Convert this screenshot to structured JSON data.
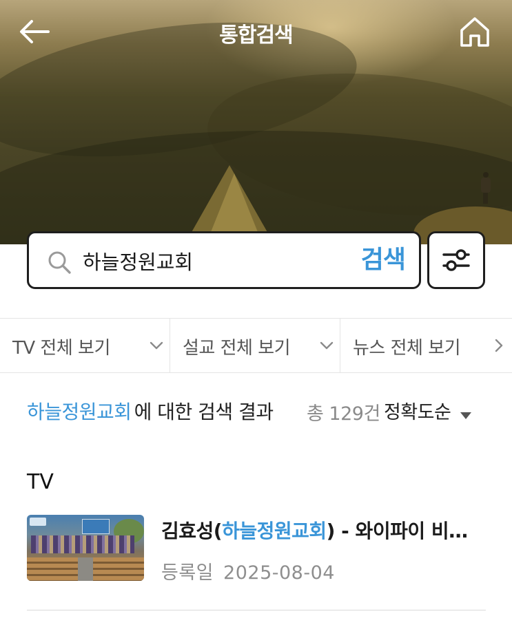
{
  "header": {
    "title": "통합검색",
    "back_icon": "back-arrow-icon",
    "home_icon": "home-icon"
  },
  "search": {
    "value": "하늘정원교회",
    "submit_label": "검색",
    "search_icon": "magnifier-icon",
    "filter_icon": "sliders-icon"
  },
  "categories": [
    {
      "label": "TV 전체 보기",
      "icon": "chevron-down-icon"
    },
    {
      "label": "설교 전체 보기",
      "icon": "chevron-down-icon"
    },
    {
      "label": "뉴스 전체 보기",
      "icon": "chevron-right-icon"
    }
  ],
  "results": {
    "keyword": "하늘정원교회",
    "suffix": "에 대한 검색 결과",
    "count": "총 129건",
    "sort": "정확도순"
  },
  "sections": [
    {
      "title": "TV",
      "items": [
        {
          "title_prefix": "김효성(",
          "title_highlight": "하늘정원교회",
          "title_suffix": ") - 와이파이 비…",
          "date_label": "등록일",
          "date": "2025-08-04"
        }
      ]
    }
  ],
  "colors": {
    "accent": "#3a95d8",
    "border": "#1e1e1e",
    "muted": "#8e8e8e"
  }
}
